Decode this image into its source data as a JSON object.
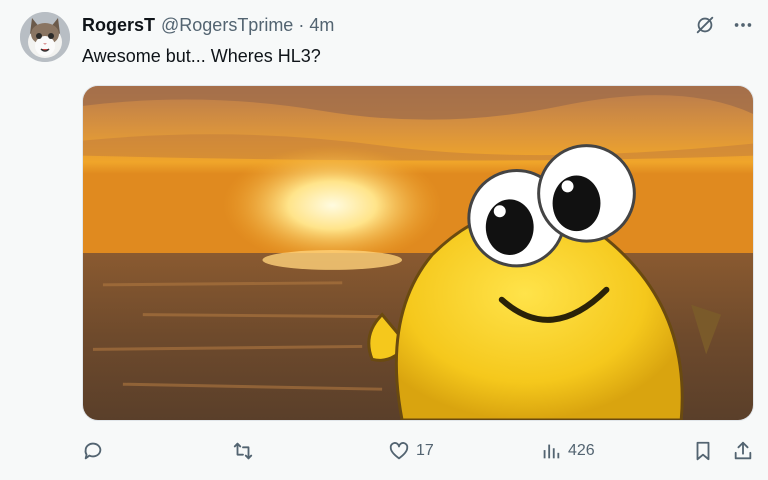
{
  "tweet": {
    "author_name": "RogersT",
    "author_handle": "@RogersTprime",
    "separator": "·",
    "time_ago": "4m",
    "text": "Awesome but... Wheres HL3?"
  },
  "actions": {
    "reply": {
      "icon": "reply-icon"
    },
    "retweet": {
      "icon": "retweet-icon"
    },
    "like": {
      "icon": "heart-icon",
      "count": "17"
    },
    "views": {
      "icon": "analytics-icon",
      "count": "426"
    },
    "bookmark": {
      "icon": "bookmark-icon"
    },
    "share": {
      "icon": "share-icon"
    }
  },
  "top_icons": [
    "grok-icon",
    "more-icon"
  ],
  "colors": {
    "text": "#0f1419",
    "muted": "#536471",
    "background": "#f7f9f9"
  }
}
